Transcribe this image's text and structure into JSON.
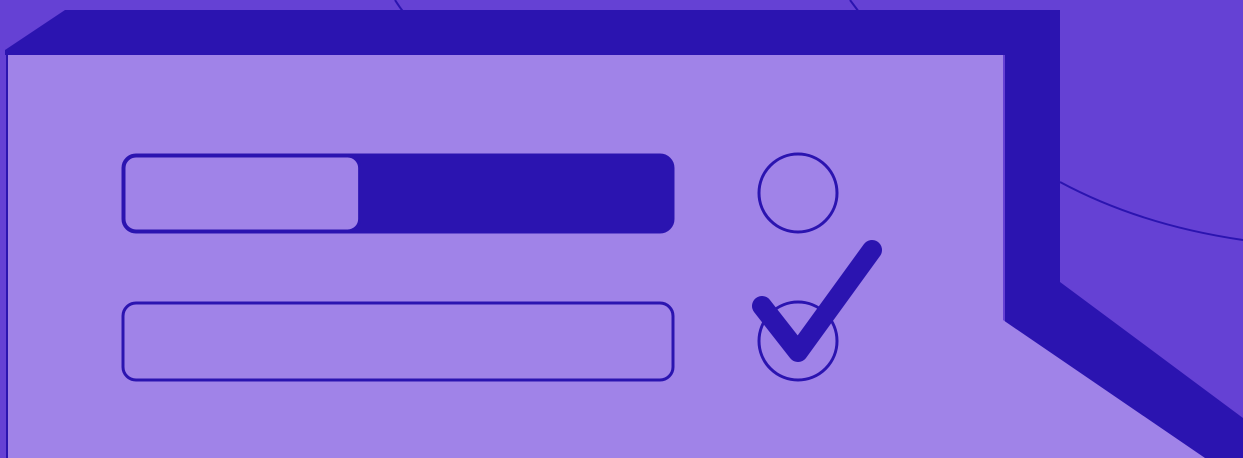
{
  "colors": {
    "background": "#6541d4",
    "panel_fill": "#a083e8",
    "panel_shadow": "#2b14b0",
    "stroke": "#2b14b0",
    "decor_line": "#2b14b0"
  },
  "progress_bar": {
    "fill_fraction": 0.43,
    "icon": "progress-bar-icon"
  },
  "empty_bar": {
    "fill_fraction": 0,
    "icon": "empty-input-bar-icon"
  },
  "radio_top": {
    "checked": false,
    "icon": "radio-circle-icon"
  },
  "radio_bottom": {
    "checked": true,
    "icon": "checkmark-icon"
  }
}
